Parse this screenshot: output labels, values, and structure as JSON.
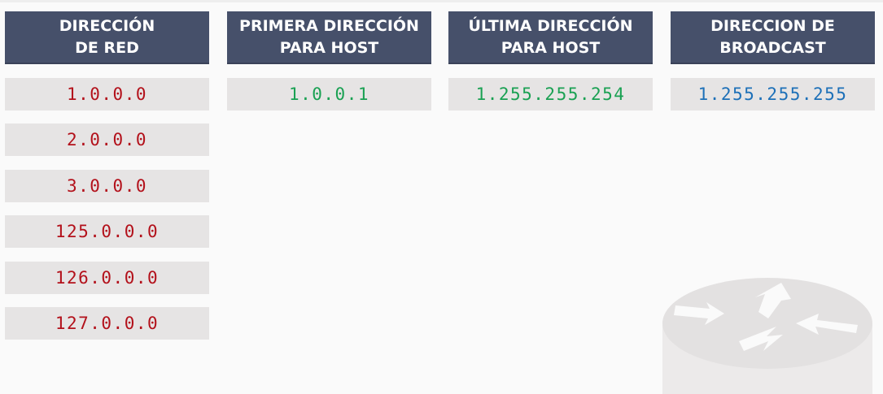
{
  "headers": {
    "network": "DIRECCIÓN\nDE RED",
    "first_host": "PRIMERA DIRECCIÓN\nPARA HOST",
    "last_host": "ÚLTIMA DIRECCIÓN\nPARA HOST",
    "broadcast": "DIRECCION DE\nBROADCAST"
  },
  "network_addresses": [
    "1.0.0.0",
    "2.0.0.0",
    "3.0.0.0",
    "125.0.0.0",
    "126.0.0.0",
    "127.0.0.0"
  ],
  "first_host": "1.0.0.1",
  "last_host": "1.255.255.254",
  "broadcast": "1.255.255.255",
  "colors": {
    "header_bg": "#46506a",
    "network_text": "#b3111b",
    "host_text": "#1aa153",
    "broadcast_text": "#1d70b8",
    "cell_bg": "#e6e4e4"
  },
  "icons": {
    "watermark": "router-icon"
  }
}
